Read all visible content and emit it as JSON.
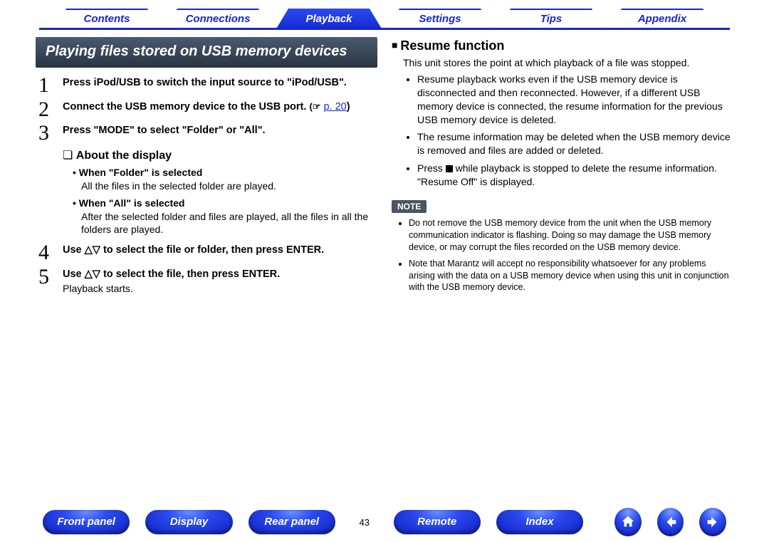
{
  "topnav": {
    "tabs": [
      {
        "label": "Contents",
        "active": false
      },
      {
        "label": "Connections",
        "active": false
      },
      {
        "label": "Playback",
        "active": true
      },
      {
        "label": "Settings",
        "active": false
      },
      {
        "label": "Tips",
        "active": false
      },
      {
        "label": "Appendix",
        "active": false
      }
    ]
  },
  "left": {
    "title": "Playing files stored on USB memory devices",
    "steps": {
      "s1": "Press iPod/USB to switch the input source to \"iPod/USB\".",
      "s2": "Connect the USB memory device to the USB port.",
      "s2_ref_prefix": "(☞",
      "s2_ref": "p. 20",
      "s2_ref_suffix": ")",
      "s3": "Press \"MODE\" to select \"Folder\" or \"All\".",
      "about_heading": "About the display",
      "d1_title": "When \"Folder\" is selected",
      "d1_body": "All the files in the selected folder are played.",
      "d2_title": "When \"All\" is selected",
      "d2_body": "After the selected folder and files are played, all the files in all the folders are played.",
      "s4": "Use △▽ to select the file or folder, then press ENTER.",
      "s5": "Use △▽ to select the file, then press ENTER.",
      "s5_sub": "Playback starts."
    }
  },
  "right": {
    "heading": "Resume function",
    "intro": "This unit stores the point at which playback of a file was stopped.",
    "bullets": {
      "b1": "Resume playback works even if the USB memory device is disconnected and then reconnected. However, if a different USB memory device is connected, the resume information for the previous USB memory device is deleted.",
      "b2": "The resume information may be deleted when the USB memory device is removed and files are added or deleted.",
      "b3a": "Press ",
      "b3b": " while playback is stopped to delete the resume information. \"Resume Off\" is displayed."
    },
    "note_label": "NOTE",
    "notes": {
      "n1": "Do not remove the USB memory device from the unit when the USB memory communication indicator is flashing. Doing so may damage the USB memory device, or may corrupt the files recorded on the USB memory device.",
      "n2": "Note that Marantz will accept no responsibility whatsoever for any problems arising with the data on a USB memory device when using this unit in conjunction with the USB memory device."
    }
  },
  "bottom": {
    "front": "Front panel",
    "display": "Display",
    "rear": "Rear panel",
    "page": "43",
    "remote": "Remote",
    "index": "Index"
  }
}
